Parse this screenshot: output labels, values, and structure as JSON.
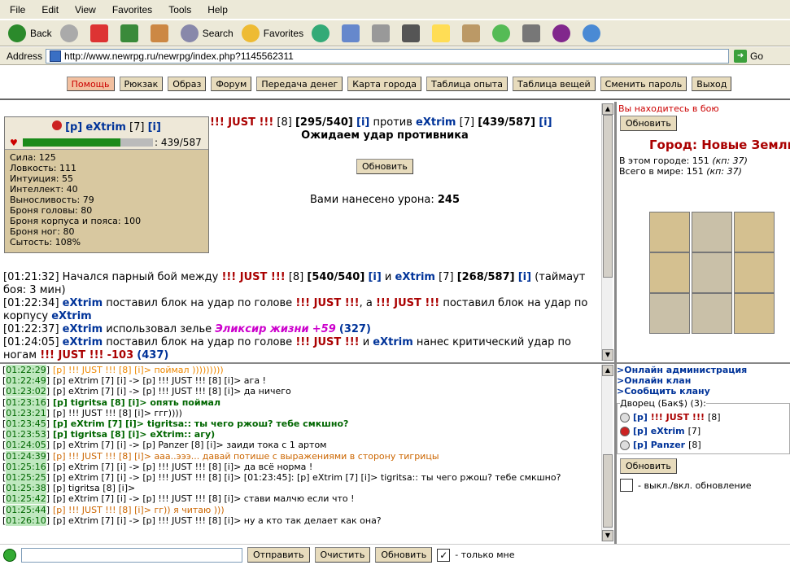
{
  "menu": [
    "File",
    "Edit",
    "View",
    "Favorites",
    "Tools",
    "Help"
  ],
  "toolbar": {
    "back": "Back",
    "search": "Search",
    "favorites": "Favorites"
  },
  "address": {
    "label": "Address",
    "url": "http://www.newrpg.ru/newrpg/index.php?1145562311",
    "go": "Go"
  },
  "nav": [
    "Помощь",
    "Рюкзак",
    "Образ",
    "Форум",
    "Передача денег",
    "Карта города",
    "Таблица опыта",
    "Таблица вещей",
    "Сменить пароль",
    "Выход"
  ],
  "player": {
    "tag": "[p]",
    "name": "eXtrim",
    "level": "[7]",
    "info": "[i]",
    "hp": ": 439/587"
  },
  "stats": [
    "Сила: 125",
    "Ловкость: 111",
    "Интуиция: 55",
    "Интеллект: 40",
    "Выносливость: 79",
    "Броня головы: 80",
    "Броня корпуса и пояса: 100",
    "Броня ног: 80",
    "Сытость: 108%"
  ],
  "battle": {
    "opp": "!!! JUST !!!",
    "opp_lvl": "[8]",
    "opp_hp": "[295/540]",
    "info": "[i]",
    "vs": "против",
    "me": "eXtrim",
    "me_lvl": "[7]",
    "me_hp": "[439/587]",
    "waiting": "Ожидаем удар противника",
    "refresh": "Обновить",
    "damage_label": "Вами нанесено урона:",
    "damage": "245"
  },
  "log": [
    {
      "t": "[01:21:32]",
      "a": "Начался парный бой между",
      "b": "!!! JUST !!!",
      "c": "[8]",
      "d": "[540/540]",
      "e": "[i]",
      "f": "и",
      "g": "eXtrim",
      "h": "[7]",
      "i": "[268/587]",
      "j": "[i]",
      "k": "(таймаут боя: 3 мин)"
    },
    {
      "t": "[01:22:34]",
      "a": "eXtrim",
      "b": "поставил блок на удар по голове",
      "c": "!!! JUST !!!",
      "d": ", а",
      "e": "!!! JUST !!!",
      "f": "поставил блок на удар по корпусу",
      "g": "eXtrim"
    },
    {
      "t": "[01:22:37]",
      "a": "eXtrim",
      "b": "использовал зелье",
      "c": "Эликсир жизни",
      "d": "+59",
      "e": "(327)"
    },
    {
      "t": "[01:24:05]",
      "a": "eXtrim",
      "b": "поставил блок на удар по голове",
      "c": "!!! JUST !!!",
      "d": "и",
      "e": "eXtrim",
      "f": "нанес критический удар по ногам",
      "g": "!!! JUST !!!",
      "h": "-103",
      "i": "(437)"
    }
  ],
  "right": {
    "in_battle": "Вы находитесь в бою",
    "refresh": "Обновить",
    "city": "Город: Новые Земли",
    "in_city": "В этом городе: 151",
    "in_city_kp": "(кп: 37)",
    "in_world": "Всего в мире: 151",
    "in_world_kp": "(кп: 37)"
  },
  "chat": [
    {
      "time": "01:22:29",
      "text": "[p] !!! JUST !!! [8] [i]> поймал )))))))))"
    },
    {
      "time": "01:22:49",
      "text": "[p] eXtrim [7] [i] -> [p] !!! JUST !!! [8] [i]> ага !"
    },
    {
      "time": "01:23:02",
      "text": "[p] eXtrim [7] [i] -> [p] !!! JUST !!! [8] [i]> да ничего"
    },
    {
      "time": "01:23:16",
      "text": "[p] tigritsa [8] [i]> опять поймал"
    },
    {
      "time": "01:23:21",
      "text": "[p] !!! JUST !!! [8] [i]> ггг))))"
    },
    {
      "time": "01:23:45",
      "text": "[p] eXtrim [7] [i]> tigritsa:: ты чего ржош? тебе смкшно?"
    },
    {
      "time": "01:23:53",
      "text": "[p] tigritsa [8] [i]> eXtrim:: агу)"
    },
    {
      "time": "01:24:05",
      "text": "[p] eXtrim [7] [i] -> [p] Panzer [8] [i]> заиди тока с 1 артом"
    },
    {
      "time": "01:24:39",
      "text": "[p] !!! JUST !!! [8] [i]> ааа..эээ... давай потише с выражениями в сторону тигрицы"
    },
    {
      "time": "01:25:16",
      "text": "[p] eXtrim [7] [i] -> [p] !!! JUST !!! [8] [i]> да всё норма !"
    },
    {
      "time": "01:25:25",
      "text": "[p] eXtrim [7] [i] -> [p] !!! JUST !!! [8] [i]> [01:23:45]: [p] eXtrim [7] [i]> tigritsa:: ты чего ржош? тебе смкшно?"
    },
    {
      "time": "01:25:38",
      "text": "[p] tigritsa [8] [i]>"
    },
    {
      "time": "01:25:42",
      "text": "[p] eXtrim [7] [i] -> [p] !!! JUST !!! [8] [i]> стави малчю если что !"
    },
    {
      "time": "01:25:44",
      "text": "[p] !!! JUST !!! [8] [i]> гг)) я читаю )))"
    },
    {
      "time": "01:26:10",
      "text": "[p] eXtrim [7] [i] -> [p] !!! JUST !!! [8] [i]> ну а кто так делает как она?"
    }
  ],
  "links": [
    ">Онлайн администрация",
    ">Онлайн клан",
    ">Сообщить клану"
  ],
  "clan": {
    "title": "Дворец (Бак$) (3):",
    "members": [
      {
        "name": "!!! JUST !!!",
        "lvl": "[8]"
      },
      {
        "name": "eXtrim",
        "lvl": "[7]"
      },
      {
        "name": "Panzer",
        "lvl": "[8]"
      }
    ],
    "refresh": "Обновить",
    "toggle": "- выкл./вкл. обновление"
  },
  "bottom": {
    "send": "Отправить",
    "clear": "Очистить",
    "refresh": "Обновить",
    "only_me": "- только мне"
  }
}
